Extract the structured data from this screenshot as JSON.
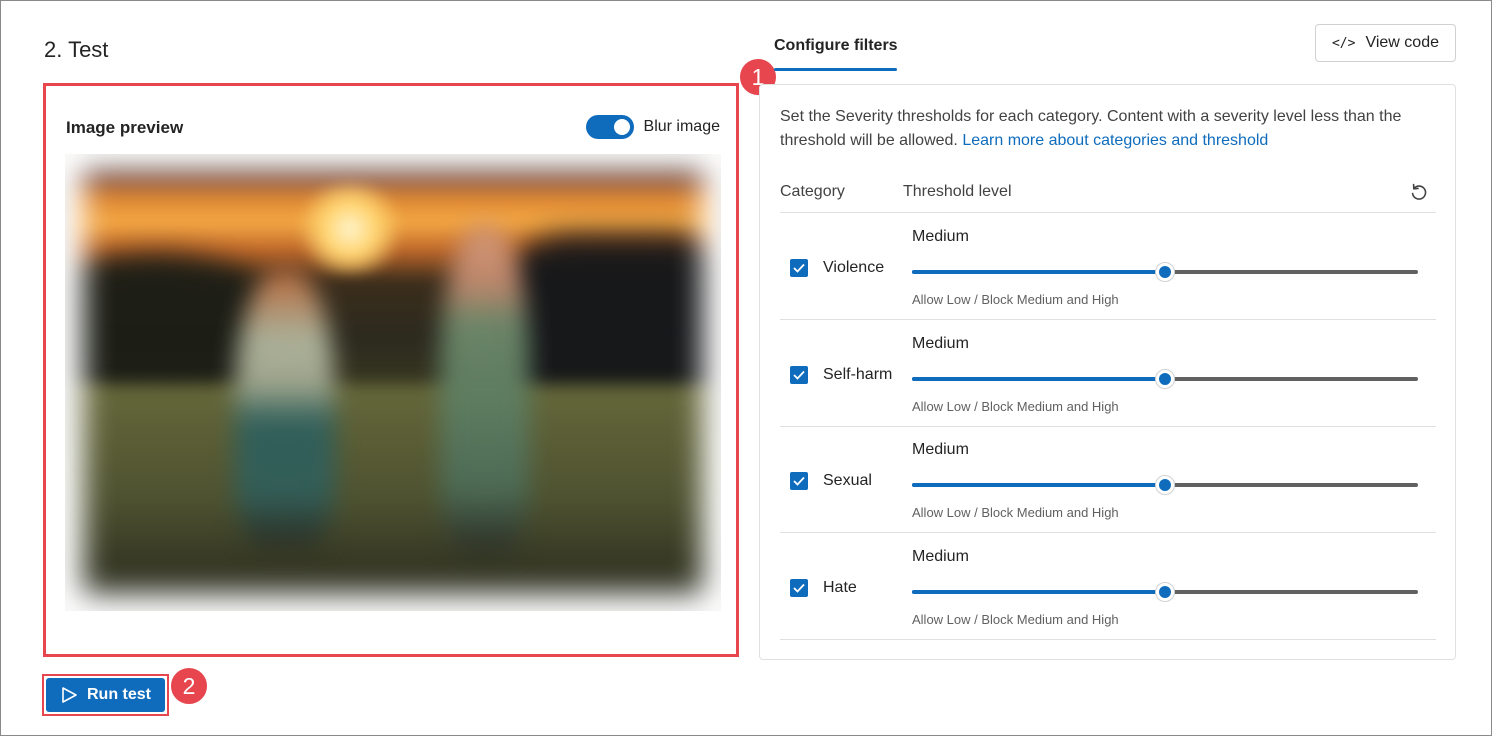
{
  "section": {
    "title": "2. Test"
  },
  "preview": {
    "title": "Image preview",
    "blur_toggle": {
      "label": "Blur image",
      "on": true
    }
  },
  "tabs": [
    {
      "label": "Configure filters",
      "active": true
    }
  ],
  "toolbar": {
    "view_code_label": "View code",
    "view_code_icon": "</>"
  },
  "annotations": {
    "badge1": "1",
    "badge2": "2"
  },
  "filters": {
    "description": "Set the Severity thresholds for each category. Content with a severity level less than the threshold will be allowed.",
    "learn_more": "Learn more about categories and threshold",
    "header": {
      "category": "Category",
      "threshold": "Threshold level"
    },
    "rows": [
      {
        "category": "Violence",
        "checked": true,
        "level": "Medium",
        "slider_value": 0.5,
        "hint": "Allow Low / Block Medium and High"
      },
      {
        "category": "Self-harm",
        "checked": true,
        "level": "Medium",
        "slider_value": 0.5,
        "hint": "Allow Low / Block Medium and High"
      },
      {
        "category": "Sexual",
        "checked": true,
        "level": "Medium",
        "slider_value": 0.5,
        "hint": "Allow Low / Block Medium and High"
      },
      {
        "category": "Hate",
        "checked": true,
        "level": "Medium",
        "slider_value": 0.5,
        "hint": "Allow Low / Block Medium and High"
      }
    ]
  },
  "run_button": {
    "label": "Run test"
  },
  "colors": {
    "accent": "#0f6cbd",
    "annotation": "#e8464f"
  }
}
